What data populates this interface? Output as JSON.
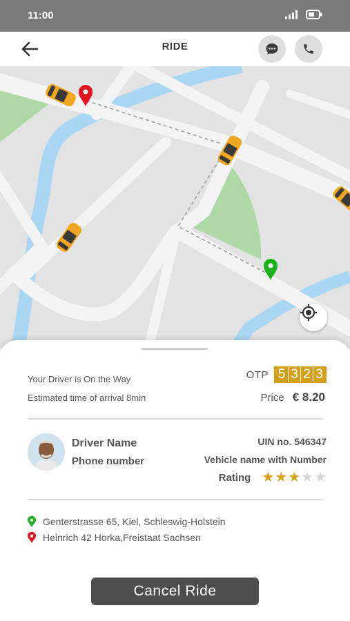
{
  "status_bar": {
    "time": "11:00"
  },
  "header": {
    "title": "RIDE"
  },
  "trip": {
    "driver_status": "Your Driver is On the Way",
    "eta_text": "Estimated time of arrival 8min",
    "otp_label": "OTP",
    "otp_digits": [
      "5",
      "3",
      "2",
      "3"
    ],
    "price_label": "Price",
    "price_value": "€ 8.20"
  },
  "driver": {
    "name": "Driver Name",
    "phone": "Phone number",
    "uin": "UIN no. 546347",
    "vehicle": "Vehicle name with Number",
    "rating_label": "Rating",
    "rating_value": 3,
    "rating_max": 5
  },
  "route": {
    "pickup": "Genterstrasse 65, Kiel, Schleswig-Holstein",
    "dropoff": "Heinrich 42 Horka,Freistaat Sachsen"
  },
  "actions": {
    "cancel_label": "Cancel Ride"
  },
  "colors": {
    "status_bar": "#7a7a7a",
    "accent_gold": "#d4a017",
    "pickup_pin": "#1db11d",
    "dropoff_pin": "#e0151f",
    "water": "#a9d6f2",
    "park": "#aed9a7",
    "button": "#4d4d4d"
  },
  "icons": {
    "back": "arrow-left-icon",
    "chat": "chat-bubble-icon",
    "call": "phone-icon",
    "locate": "crosshair-icon",
    "pickup": "map-pin-green-icon",
    "dropoff": "map-pin-red-icon"
  }
}
